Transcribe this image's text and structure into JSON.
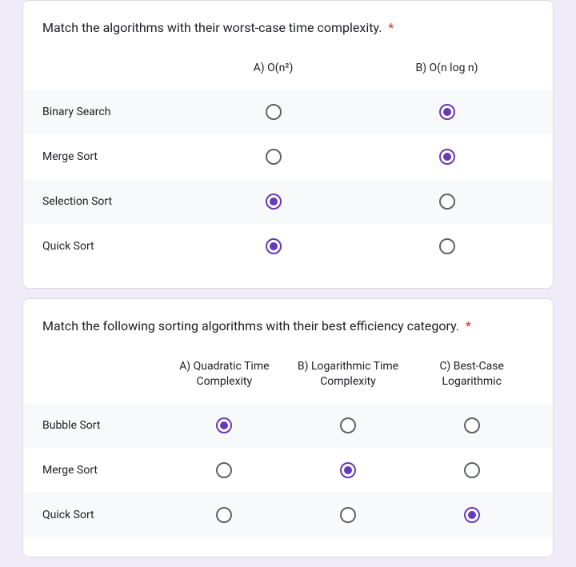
{
  "questions": [
    {
      "title": "Match the algorithms with their worst-case time complexity.",
      "required": "*",
      "columns": [
        "A) O(n²)",
        "B) O(n log n)"
      ],
      "rows": [
        {
          "label": "Binary Search",
          "selected": 1
        },
        {
          "label": "Merge Sort",
          "selected": 1
        },
        {
          "label": "Selection Sort",
          "selected": 0
        },
        {
          "label": "Quick Sort",
          "selected": 0
        }
      ]
    },
    {
      "title": "Match the following sorting algorithms with their best efficiency category.",
      "required": "*",
      "columns": [
        "A) Quadratic Time Complexity",
        "B) Logarithmic Time Complexity",
        "C) Best-Case Logarithmic"
      ],
      "rows": [
        {
          "label": "Bubble Sort",
          "selected": 0
        },
        {
          "label": "Merge Sort",
          "selected": 1
        },
        {
          "label": "Quick Sort",
          "selected": 2
        }
      ]
    }
  ]
}
